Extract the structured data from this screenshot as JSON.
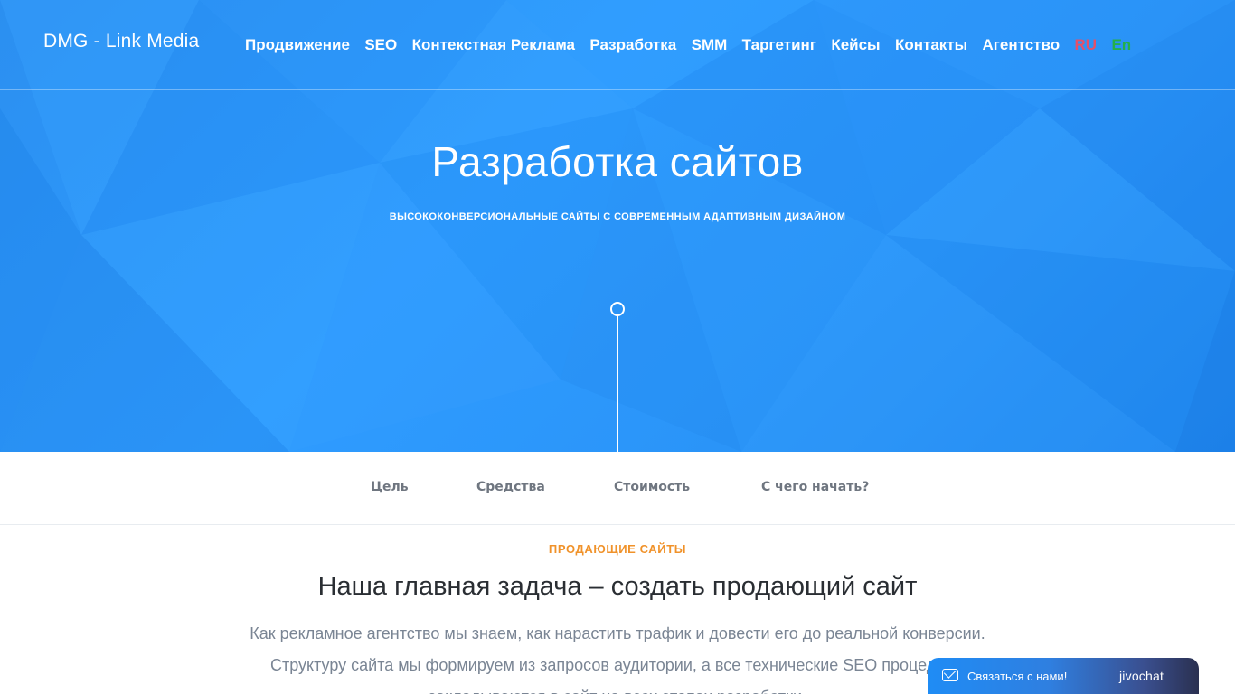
{
  "header": {
    "logo": "DMG - Link Media",
    "nav": [
      "Продвижение",
      "SEO",
      "Контекстная Реклама",
      "Разработка",
      "SMM",
      "Таргетинг",
      "Кейсы",
      "Контакты",
      "Агентство"
    ],
    "lang_ru": "RU",
    "lang_en": "En"
  },
  "hero": {
    "title": "Разработка сайтов",
    "subtitle": "ВЫСОКОКОНВЕРСИОНАЛЬНЫЕ САЙТЫ С СОВРЕМЕННЫМ АДАПТИВНЫМ ДИЗАЙНОМ"
  },
  "subnav": [
    "Цель",
    "Средства",
    "Стоимость",
    "С чего начать?"
  ],
  "section": {
    "tag": "ПРОДАЮЩИЕ САЙТЫ",
    "title": "Наша главная задача – создать продающий сайт",
    "text": "Как рекламное агентство мы знаем, как нарастить трафик и довести его до реальной конверсии. Структуру сайта мы формируем из запросов аудитории, а все технические SEO процедуры закладываются в сайт на всех этапах разработки."
  },
  "chat": {
    "label": "Связаться с нами!",
    "brand": "jivochat",
    "icon": "envelope-icon"
  },
  "colors": {
    "hero_blue": "#2f9cff",
    "lang_ru": "#e4506a",
    "lang_en": "#24b04a",
    "tag_orange": "#f0922a"
  }
}
